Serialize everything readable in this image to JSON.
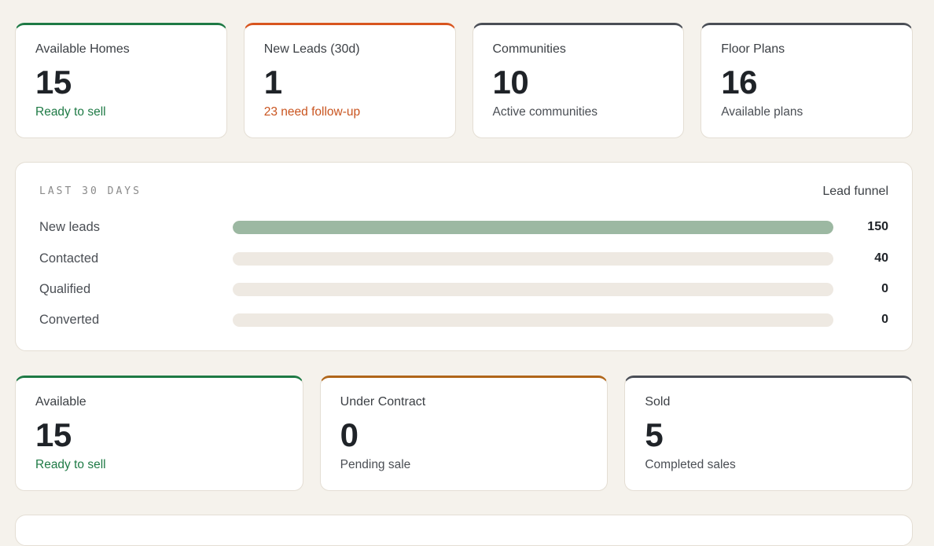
{
  "top_stats": [
    {
      "label": "Available Homes",
      "value": "15",
      "sub": "Ready to sell",
      "accent": "#1e7a45",
      "sub_color": "#1e7a45"
    },
    {
      "label": "New Leads (30d)",
      "value": "1",
      "sub": "23 need follow-up",
      "accent": "#d8551f",
      "sub_color": "#c9541f"
    },
    {
      "label": "Communities",
      "value": "10",
      "sub": "Active communities",
      "accent": "#4a4e56",
      "sub_color": "#4a4e54"
    },
    {
      "label": "Floor Plans",
      "value": "16",
      "sub": "Available plans",
      "accent": "#4a4e56",
      "sub_color": "#4a4e54"
    }
  ],
  "funnel": {
    "eyebrow": "LAST 30 DAYS",
    "title": "Lead funnel",
    "max": 150,
    "fill_color": "#9cb8a2",
    "rows": [
      {
        "label": "New leads",
        "count": "150",
        "value": 150
      },
      {
        "label": "Contacted",
        "count": "40",
        "value": 0
      },
      {
        "label": "Qualified",
        "count": "0",
        "value": 0
      },
      {
        "label": "Converted",
        "count": "0",
        "value": 0
      }
    ]
  },
  "bottom_stats": [
    {
      "label": "Available",
      "value": "15",
      "sub": "Ready to sell",
      "accent": "#1e7a45",
      "sub_color": "#1e7a45"
    },
    {
      "label": "Under Contract",
      "value": "0",
      "sub": "Pending sale",
      "accent": "#b0661a",
      "sub_color": "#4a4e54"
    },
    {
      "label": "Sold",
      "value": "5",
      "sub": "Completed sales",
      "accent": "#4a4e56",
      "sub_color": "#4a4e54"
    }
  ]
}
